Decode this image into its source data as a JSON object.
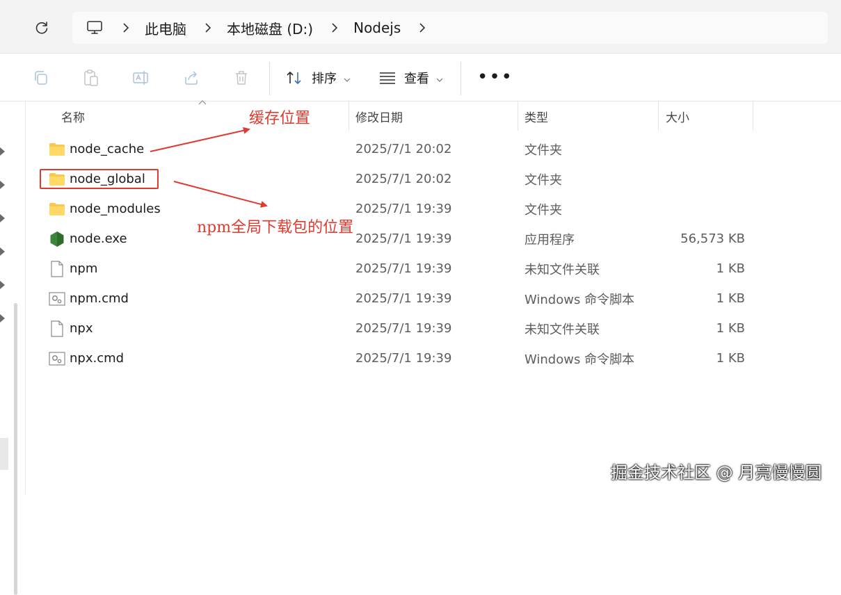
{
  "address_bar": {
    "crumbs": [
      "此电脑",
      "本地磁盘 (D:)",
      "Nodejs"
    ]
  },
  "toolbar": {
    "sort_label": "排序",
    "view_label": "查看",
    "more_label": "•••"
  },
  "columns": {
    "name": "名称",
    "modified": "修改日期",
    "type": "类型",
    "size": "大小"
  },
  "files": [
    {
      "name": "node_cache",
      "modified": "2025/7/1 20:02",
      "type": "文件夹",
      "size": "",
      "icon": "folder-icon"
    },
    {
      "name": "node_global",
      "modified": "2025/7/1 20:02",
      "type": "文件夹",
      "size": "",
      "icon": "folder-icon"
    },
    {
      "name": "node_modules",
      "modified": "2025/7/1 19:39",
      "type": "文件夹",
      "size": "",
      "icon": "folder-icon"
    },
    {
      "name": "node.exe",
      "modified": "2025/7/1 19:39",
      "type": "应用程序",
      "size": "56,573 KB",
      "icon": "nodejs-exe-icon"
    },
    {
      "name": "npm",
      "modified": "2025/7/1 19:39",
      "type": "未知文件关联",
      "size": "1 KB",
      "icon": "file-icon"
    },
    {
      "name": "npm.cmd",
      "modified": "2025/7/1 19:39",
      "type": "Windows 命令脚本",
      "size": "1 KB",
      "icon": "cmd-script-icon"
    },
    {
      "name": "npx",
      "modified": "2025/7/1 19:39",
      "type": "未知文件关联",
      "size": "1 KB",
      "icon": "file-icon"
    },
    {
      "name": "npx.cmd",
      "modified": "2025/7/1 19:39",
      "type": "Windows 命令脚本",
      "size": "1 KB",
      "icon": "cmd-script-icon"
    }
  ],
  "annotations": {
    "cache_note": "缓存位置",
    "global_note": "npm全局下载包的位置"
  },
  "watermark": "掘金技术社区 @ 月亮慢慢圆",
  "colors": {
    "annotation_red": "#e03a2f",
    "folder_yellow": "#f8c94a",
    "node_green": "#3c873a"
  }
}
